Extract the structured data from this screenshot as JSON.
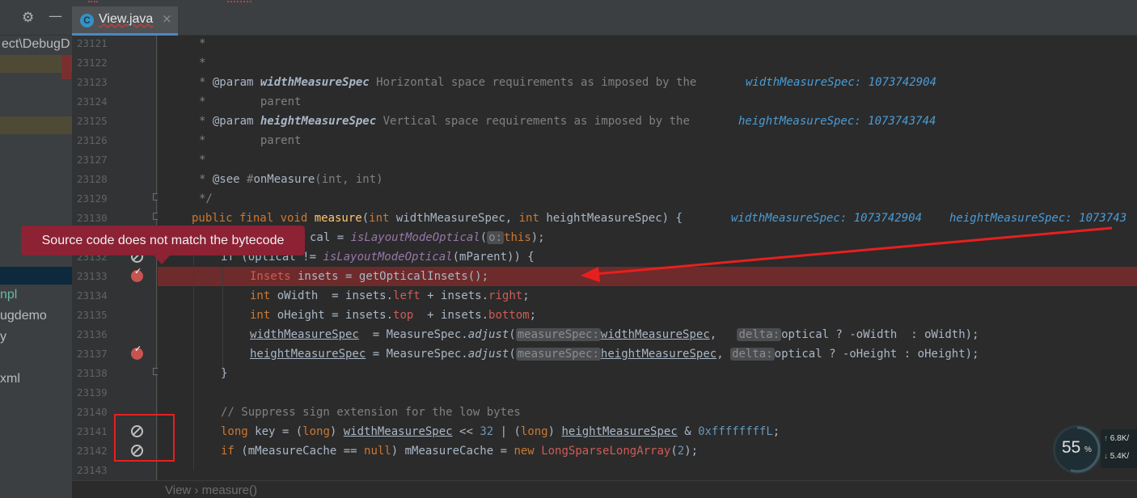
{
  "project_panel": {
    "toolbar_icons": [
      "gear-icon",
      "minimize-icon"
    ],
    "path_text": "ect\\DebugD",
    "items": [
      "npl",
      "ugdemo",
      "y",
      "xml"
    ]
  },
  "tabs": [
    {
      "label": "View.java",
      "icon": "C",
      "close": "×",
      "active": true
    }
  ],
  "tooltip": {
    "text": "Source code does not match the bytecode"
  },
  "breadcrumb": {
    "class": "View",
    "separator": "›",
    "method": "measure()"
  },
  "widget": {
    "percent": "55",
    "percent_sign": "%",
    "up": "6.8",
    "up_unit": "K/",
    "down": "5.4",
    "down_unit": "K/",
    "up_arrow": "↑",
    "down_arrow": "↓"
  },
  "line_numbers": [
    "23121",
    "23122",
    "23123",
    "23124",
    "23125",
    "23126",
    "23127",
    "23128",
    "23129",
    "23130",
    "23131",
    "23132",
    "23133",
    "23134",
    "23135",
    "23136",
    "23137",
    "23138",
    "23139",
    "23140",
    "23141",
    "23142",
    "23143"
  ],
  "code": {
    "l23121": "*",
    "l23122": "*",
    "l23123_a": "* ",
    "l23123_tag": "@param",
    "l23123_p": "widthMeasureSpec",
    "l23123_d": " Horizontal space requirements as imposed by the",
    "l23123_hint": "widthMeasureSpec: 1073742904",
    "l23124": "*        parent",
    "l23125_a": "* ",
    "l23125_tag": "@param",
    "l23125_p": "heightMeasureSpec",
    "l23125_d": " Vertical space requirements as imposed by the",
    "l23125_hint": "heightMeasureSpec: 1073743744",
    "l23126": "*        parent",
    "l23127": "*",
    "l23128_a": "* ",
    "l23128_tag": "@see",
    "l23128_d": " #",
    "l23128_link": "onMeasure",
    "l23128_e": "(int, int)",
    "l23129": "*/",
    "l23130_kw": "public final void ",
    "l23130_n": "measure",
    "l23130_a": "(",
    "l23130_t1": "int ",
    "l23130_p1": "widthMeasureSpec, ",
    "l23130_t2": "int ",
    "l23130_p2": "heightMeasureSpec) {",
    "l23130_hint1": "widthMeasureSpec: 1073742904",
    "l23130_hint2": "heightMeasureSpec: 1073743",
    "l23131_a": "cal = ",
    "l23131_m": "isLayoutModeOptical",
    "l23131_b": "(",
    "l23131_ph": "o:",
    "l23131_kw": "this",
    "l23131_c": ");",
    "l23132_a": "if (optical != ",
    "l23132_m": "isLayoutModeOptical",
    "l23132_b": "(mParent)) {",
    "l23133_t": "Insets",
    "l23133_b": " insets = getOpticalInsets();",
    "l23134_kw": "int",
    "l23134_a": " oWidth  = insets.",
    "l23134_f1": "left",
    "l23134_b": " + insets.",
    "l23134_f2": "right",
    "l23134_c": ";",
    "l23135_kw": "int",
    "l23135_a": " oHeight = insets.",
    "l23135_f1": "top",
    "l23135_b": "  + insets.",
    "l23135_f2": "bottom",
    "l23135_c": ";",
    "l23136_v": "widthMeasureSpec",
    "l23136_a": "  = MeasureSpec.",
    "l23136_m": "adjust",
    "l23136_b": "(",
    "l23136_ph1": "measureSpec:",
    "l23136_v2": "widthMeasureSpec",
    "l23136_c": ",  ",
    "l23136_ph2": "delta:",
    "l23136_d": "optical ? -oWidth  : oWidth);",
    "l23137_v": "heightMeasureSpec",
    "l23137_a": " = MeasureSpec.",
    "l23137_m": "adjust",
    "l23137_b": "(",
    "l23137_ph1": "measureSpec:",
    "l23137_v2": "heightMeasureSpec",
    "l23137_c": ", ",
    "l23137_ph2": "delta:",
    "l23137_d": "optical ? -oHeight : oHeight);",
    "l23138": "}",
    "l23140": "// Suppress sign extension for the low bytes",
    "l23141_kw": "long",
    "l23141_a": " key = (",
    "l23141_kw2": "long",
    "l23141_b": ") ",
    "l23141_v1": "widthMeasureSpec",
    "l23141_c": " << ",
    "l23141_n1": "32",
    "l23141_d": " | (",
    "l23141_kw3": "long",
    "l23141_e": ") ",
    "l23141_v2": "heightMeasureSpec",
    "l23141_f": " & ",
    "l23141_n2": "0xffffffffL",
    "l23141_g": ";",
    "l23142_kw": "if",
    "l23142_a": " (mMeasureCache == ",
    "l23142_kw2": "null",
    "l23142_b": ") mMeasureCache = ",
    "l23142_kw3": "new",
    "l23142_c": " ",
    "l23142_cls": "LongSparseLongArray",
    "l23142_d": "(",
    "l23142_n": "2",
    "l23142_e": ");"
  },
  "colors": {
    "execution_line": "#6e2b2b",
    "tooltip": "#8c2234",
    "annotation": "#e81f1f"
  }
}
